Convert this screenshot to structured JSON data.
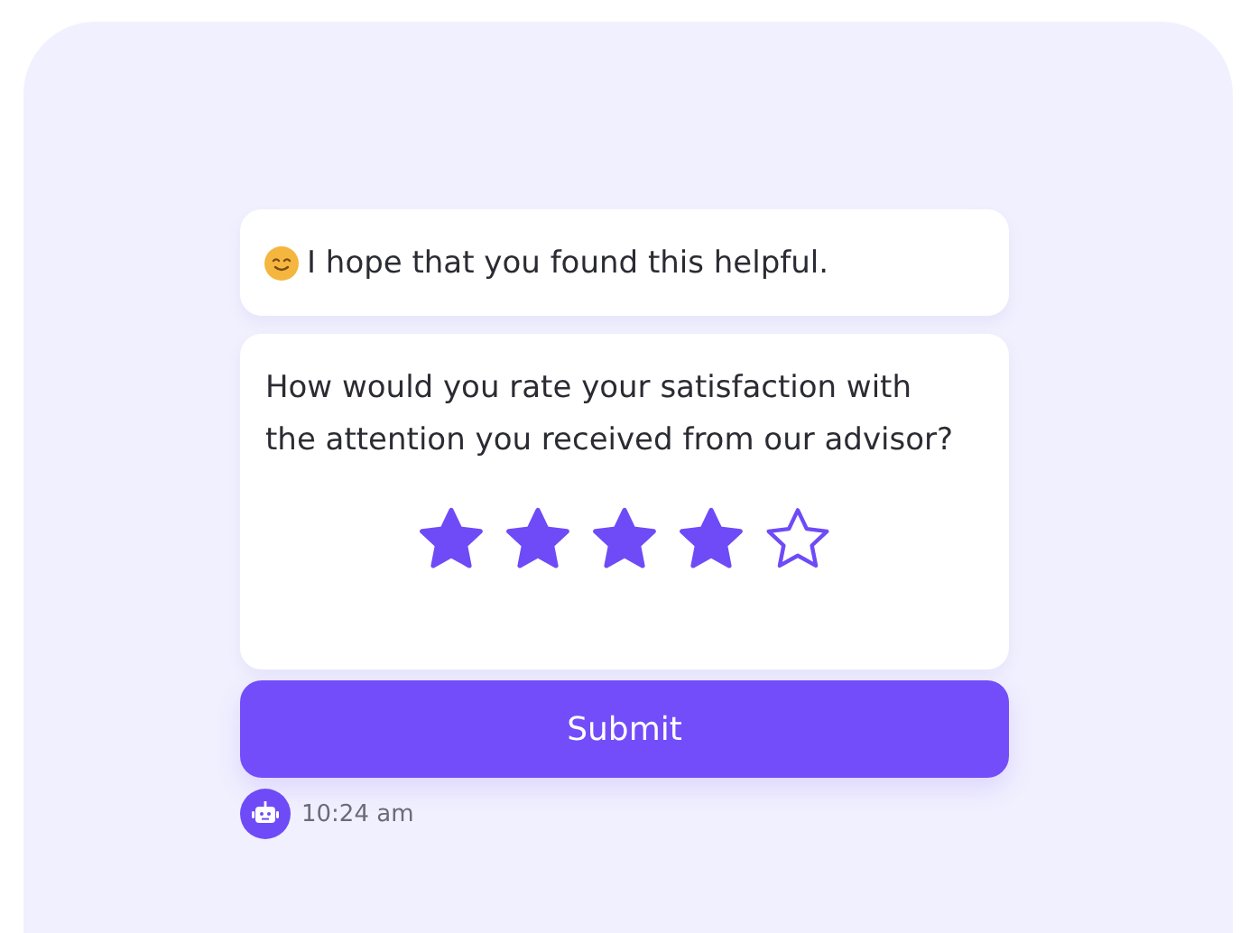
{
  "messages": [
    {
      "text": "I hope that you found this helpful."
    }
  ],
  "rating": {
    "question": "How would you rate your satisfaction with the attention you received from our advisor?",
    "stars": 4
  },
  "submit_button": {
    "label": "Submit"
  },
  "timestamp": "10:24 am"
}
